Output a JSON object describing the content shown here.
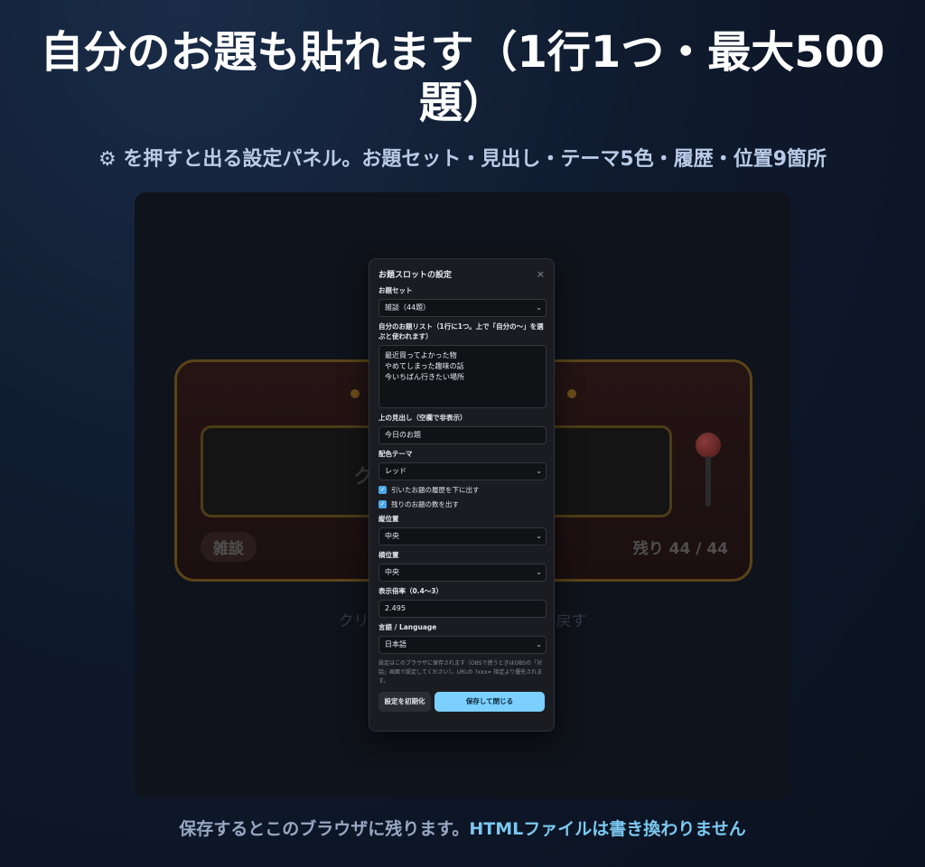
{
  "headline": "自分のお題も貼れます（1行1つ・最大500題）",
  "subline": "⚙ を押すと出る設定パネル。お題セット・見出し・テーマ5色・履歴・位置9箇所",
  "slot": {
    "window_text": "クリック… …引く",
    "set_badge": "雑談",
    "remaining": "残り 44 / 44",
    "hint": "クリック / Spa… …た物を全部戻す"
  },
  "panel": {
    "title": "お題スロットの設定",
    "close": "×",
    "set_label": "お題セット",
    "set_value": "雑談（44題）",
    "custom_label": "自分のお題リスト（1行に1つ。上で「自分の〜」を選ぶと使われます）",
    "custom_value": "最近買ってよかった物\nやめてしまった趣味の話\n今いちばん行きたい場所",
    "heading_label": "上の見出し（空欄で非表示）",
    "heading_value": "今日のお題",
    "theme_label": "配色テーマ",
    "theme_value": "レッド",
    "history_label": "引いたお題の履歴を下に出す",
    "history_checked": true,
    "count_label": "残りのお題の数を出す",
    "count_checked": true,
    "vpos_label": "縦位置",
    "vpos_value": "中央",
    "hpos_label": "横位置",
    "hpos_value": "中央",
    "scale_label": "表示倍率（0.4〜3）",
    "scale_value": "2.495",
    "lang_label": "言語 / Language",
    "lang_value": "日本語",
    "note": "設定はこのブラウザに保存されます（OBSで使うときはOBSの「対話」画面で設定してください）。URLの ?xxx= 指定より優先されます。",
    "reset_label": "設定を初期化",
    "save_label": "保存して閉じる"
  },
  "footer": {
    "text": "保存するとこのブラウザに残ります。",
    "highlight": "HTMLファイルは書き換わりません"
  },
  "colors": {
    "accent": "#7cd0ff",
    "check": "#4aa8e8"
  }
}
